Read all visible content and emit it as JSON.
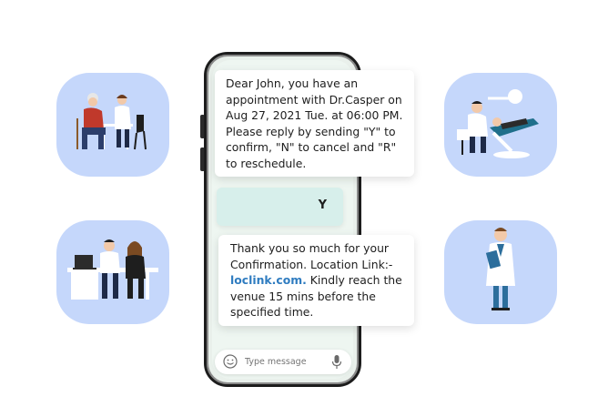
{
  "messages": {
    "incoming_1": "Dear John, you have an appointment with Dr.Casper on Aug 27, 2021 Tue. at 06:00 PM. Please reply by sending \"Y\" to confirm, \"N\" to cancel and \"R\" to reschedule.",
    "reply": "Y",
    "incoming_2": {
      "before": "Thank you so much for your Confirmation. Location Link:-",
      "link": "loclink.com.",
      "after": "Kindly reach the venue 15 mins before the specified time."
    }
  },
  "composer": {
    "placeholder": "Type message"
  },
  "colors": {
    "tile_bg": "#c5d7fb",
    "reply_bg": "#d7efeb",
    "link": "#2f7cc0"
  },
  "icons": {
    "emoji": "smiley-icon",
    "mic": "microphone-icon"
  }
}
